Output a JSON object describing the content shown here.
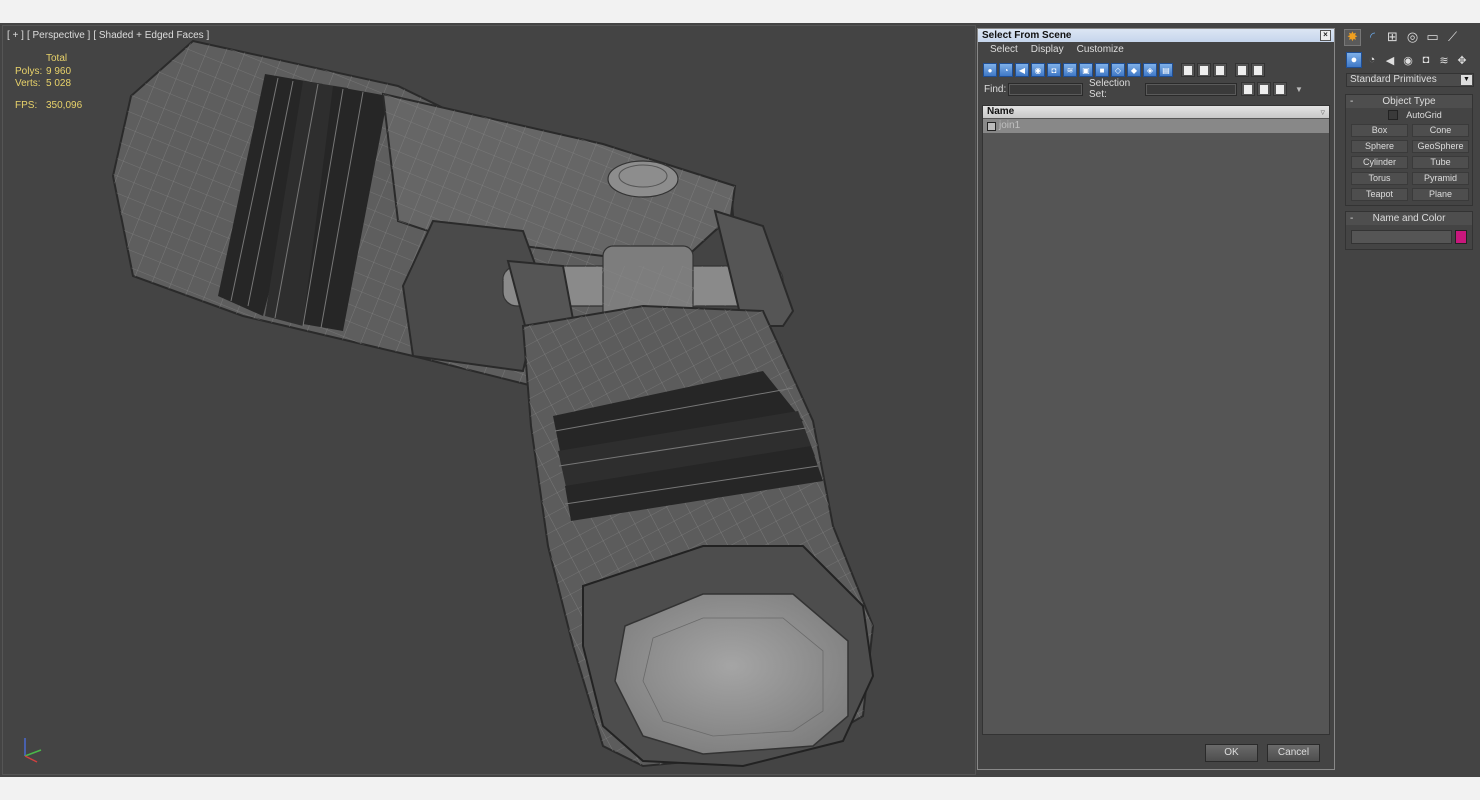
{
  "viewport": {
    "labels": [
      "[ + ]",
      "[ Perspective ]",
      "[ Shaded + Edged Faces ]"
    ],
    "stats_header": "Total",
    "stats": [
      {
        "label": "Polys:",
        "value": "9 960"
      },
      {
        "label": "Verts:",
        "value": "5 028"
      }
    ],
    "fps_label": "FPS:",
    "fps_value": "350,096",
    "stats_color": "#e8d26a"
  },
  "dialog": {
    "title": "Select From Scene",
    "close_glyph": "×",
    "menu": [
      "Select",
      "Display",
      "Customize"
    ],
    "toolbar_icons": [
      "geometry-filter-icon",
      "shapes-filter-icon",
      "lights-filter-icon",
      "cameras-filter-icon",
      "helpers-filter-icon",
      "space-warps-filter-icon",
      "groups-filter-icon",
      "xrefs-filter-icon",
      "bones-filter-icon",
      "containers-filter-icon",
      "frozen-filter-icon",
      "hidden-filter-icon"
    ],
    "find_label": "Find:",
    "find_value": "",
    "selection_set_label": "Selection Set:",
    "selection_set_value": "",
    "column_header": "Name",
    "rows": [
      {
        "name": "join1"
      }
    ],
    "ok_label": "OK",
    "cancel_label": "Cancel"
  },
  "panel": {
    "tabs": [
      {
        "name": "create-tab",
        "glyph": "✸"
      },
      {
        "name": "modify-tab",
        "glyph": "◜"
      },
      {
        "name": "hierarchy-tab",
        "glyph": "⊞"
      },
      {
        "name": "motion-tab",
        "glyph": "◎"
      },
      {
        "name": "display-tab",
        "glyph": "▭"
      },
      {
        "name": "utilities-tab",
        "glyph": "⟋"
      }
    ],
    "categories": [
      {
        "name": "geometry-icon",
        "glyph": "●"
      },
      {
        "name": "shapes-icon",
        "glyph": "◔"
      },
      {
        "name": "lights-icon",
        "glyph": "◀"
      },
      {
        "name": "cameras-icon",
        "glyph": "◉"
      },
      {
        "name": "helpers-icon",
        "glyph": "◘"
      },
      {
        "name": "space-warps-icon",
        "glyph": "≋"
      },
      {
        "name": "systems-icon",
        "glyph": "✥"
      }
    ],
    "primitive_type": "Standard Primitives",
    "object_type_title": "Object Type",
    "autogrid_label": "AutoGrid",
    "objects": [
      "Box",
      "Cone",
      "Sphere",
      "GeoSphere",
      "Cylinder",
      "Tube",
      "Torus",
      "Pyramid",
      "Teapot",
      "Plane"
    ],
    "name_color_title": "Name and Color",
    "name_value": "",
    "swatch_color": "#c8177c"
  }
}
